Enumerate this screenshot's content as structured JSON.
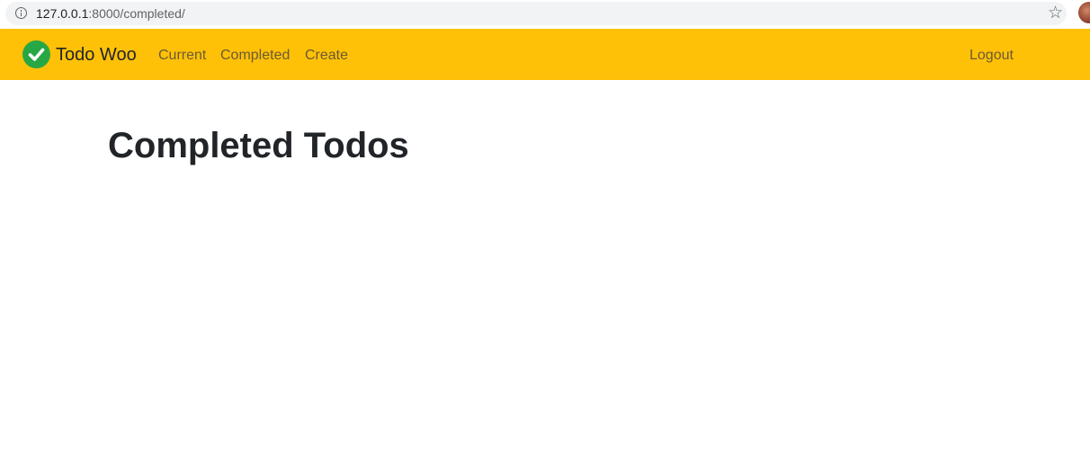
{
  "browser": {
    "url_host": "127.0.0.1",
    "url_rest": ":8000/completed/"
  },
  "navbar": {
    "brand": "Todo Woo",
    "links": [
      {
        "label": "Current"
      },
      {
        "label": "Completed"
      },
      {
        "label": "Create"
      }
    ],
    "logout_label": "Logout",
    "background_color": "#ffc107",
    "logo_color": "#28a745"
  },
  "main": {
    "title": "Completed Todos"
  },
  "icons": {
    "info": "info-icon",
    "star": "star-icon",
    "logo": "check-circle-icon"
  }
}
